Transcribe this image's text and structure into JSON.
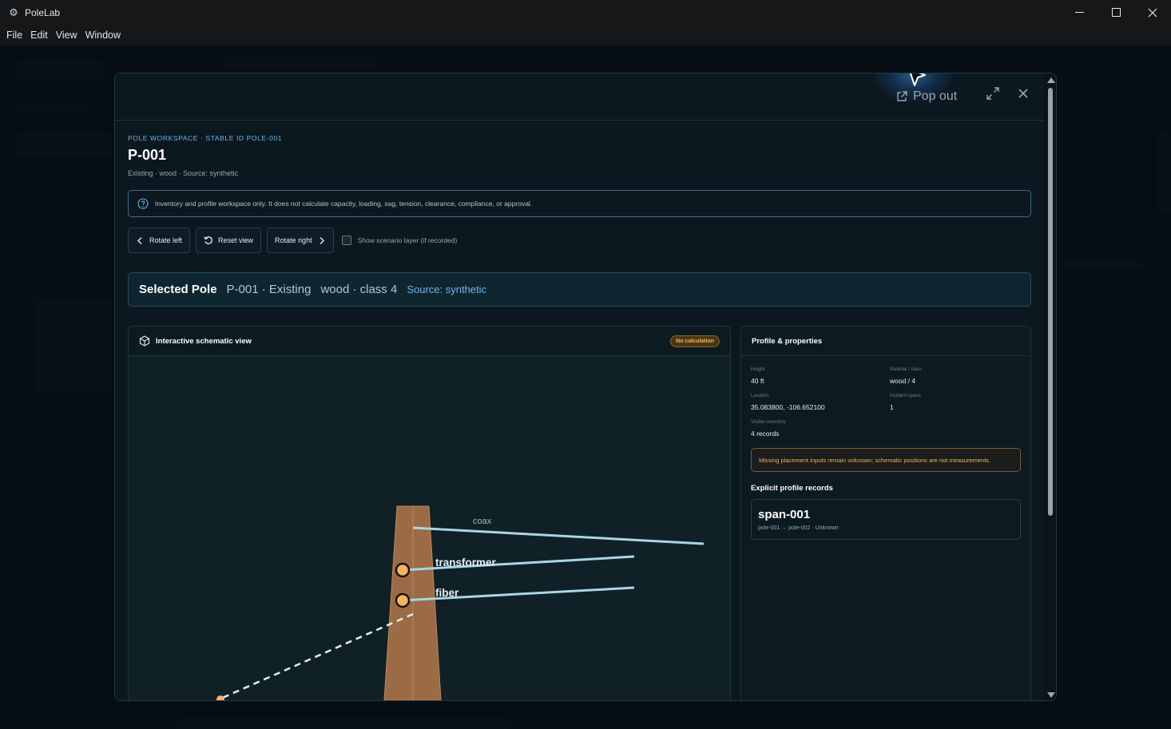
{
  "window": {
    "title": "PoleLab"
  },
  "menu": [
    "File",
    "Edit",
    "View",
    "Window"
  ],
  "modal": {
    "popout_label": "Pop out",
    "eyebrow": "POLE WORKSPACE · STABLE ID POLE-001",
    "title": "P-001",
    "subtitle": "Existing · wood · Source: synthetic",
    "info": "Inventory and profile workspace only. It does not calculate capacity, loading, sag, tension, clearance, compliance, or approval.",
    "controls": {
      "rotate_left": "Rotate left",
      "reset_view": "Reset view",
      "rotate_right": "Rotate right",
      "scenario_label": "Show scenario layer (if recorded)",
      "scenario_checked": false
    },
    "selected": {
      "label": "Selected Pole",
      "pole": "P-001 · Existing",
      "material": "wood · class 4",
      "source": "Source: synthetic"
    },
    "schematic": {
      "title": "Interactive schematic view",
      "badge": "No calculation",
      "labels": {
        "coax": "coax",
        "transformer": "transformer",
        "fiber": "fiber"
      }
    },
    "profile": {
      "title": "Profile & properties",
      "props": [
        {
          "label": "Height",
          "value": "40 ft"
        },
        {
          "label": "Material / class",
          "value": "wood / 4"
        },
        {
          "label": "Location",
          "value": "35.083800, -106.652100"
        },
        {
          "label": "Incident spans",
          "value": "1"
        },
        {
          "label": "Visible inventory",
          "value": "4 records"
        }
      ],
      "warning": "Missing placement inputs remain unknown; schematic positions are not measurements.",
      "records_title": "Explicit profile records",
      "records": [
        {
          "title": "span-001",
          "sub": "pole-001 → pole-002 · Unknown"
        }
      ]
    }
  },
  "colors": {
    "accent": "#6fb4e6",
    "badge": "#f0b45a",
    "pole": "#9b6b45",
    "wire": "#a9d6e3",
    "attachment": "#f4b460"
  }
}
